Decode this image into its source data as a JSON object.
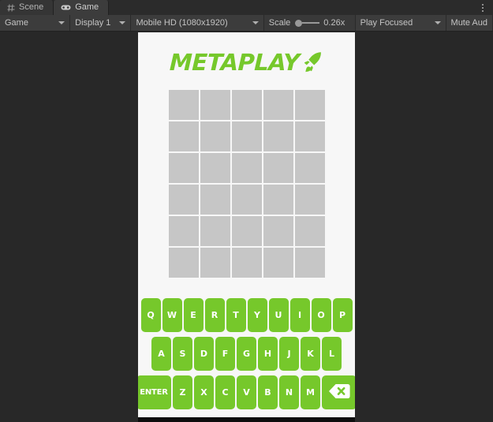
{
  "window": {
    "tabs": [
      {
        "label": "Scene",
        "icon": "grid-icon",
        "active": false
      },
      {
        "label": "Game",
        "icon": "gamepad-icon",
        "active": true
      }
    ],
    "menu_icon": "kebab-menu-icon"
  },
  "toolbar": {
    "view_mode": "Game",
    "display": "Display 1",
    "resolution": "Mobile HD (1080x1920)",
    "scale_label": "Scale",
    "scale_value": "0.26x",
    "play_mode": "Play Focused",
    "mute_audio": "Mute Aud",
    "caret_icon": "chevron-down-icon"
  },
  "game": {
    "logo": {
      "text": "METAPLAY",
      "icon": "rocket-icon",
      "color": "#76c82b"
    },
    "board": {
      "rows": 6,
      "columns": 5,
      "empty_color": "#c6c6c6",
      "cells": [
        [
          "",
          "",
          "",
          "",
          ""
        ],
        [
          "",
          "",
          "",
          "",
          ""
        ],
        [
          "",
          "",
          "",
          "",
          ""
        ],
        [
          "",
          "",
          "",
          "",
          ""
        ],
        [
          "",
          "",
          "",
          "",
          ""
        ],
        [
          "",
          "",
          "",
          "",
          ""
        ]
      ]
    },
    "keyboard": {
      "key_color": "#76c82b",
      "key_text_color": "#ffffff",
      "rows": [
        {
          "keys": [
            {
              "label": "Q"
            },
            {
              "label": "W"
            },
            {
              "label": "E"
            },
            {
              "label": "R"
            },
            {
              "label": "T"
            },
            {
              "label": "Y"
            },
            {
              "label": "U"
            },
            {
              "label": "I"
            },
            {
              "label": "O"
            },
            {
              "label": "P"
            }
          ]
        },
        {
          "keys": [
            {
              "label": "A"
            },
            {
              "label": "S"
            },
            {
              "label": "D"
            },
            {
              "label": "F"
            },
            {
              "label": "G"
            },
            {
              "label": "H"
            },
            {
              "label": "J"
            },
            {
              "label": "K"
            },
            {
              "label": "L"
            }
          ]
        },
        {
          "keys": [
            {
              "label": "ENTER",
              "type": "wide"
            },
            {
              "label": "Z"
            },
            {
              "label": "X"
            },
            {
              "label": "C"
            },
            {
              "label": "V"
            },
            {
              "label": "B"
            },
            {
              "label": "N"
            },
            {
              "label": "M"
            },
            {
              "label": "",
              "type": "backspace",
              "icon": "backspace-icon"
            }
          ]
        }
      ]
    }
  }
}
